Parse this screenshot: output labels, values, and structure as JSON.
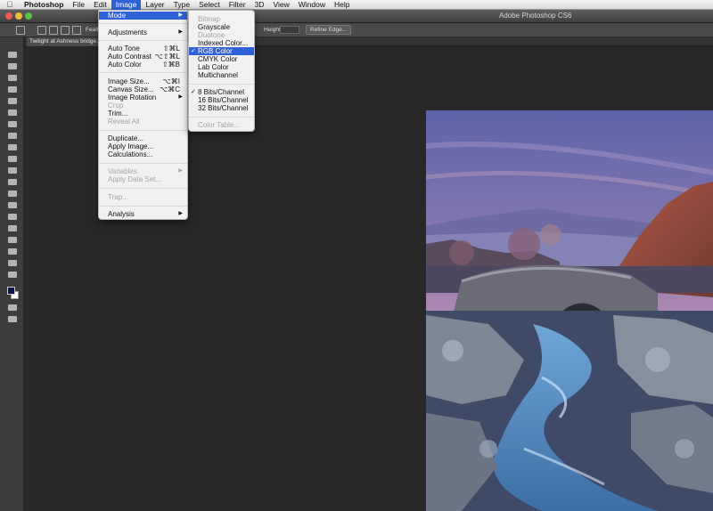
{
  "menubar": {
    "app": "Photoshop",
    "items": [
      "File",
      "Edit",
      "Image",
      "Layer",
      "Type",
      "Select",
      "Filter",
      "3D",
      "View",
      "Window",
      "Help"
    ]
  },
  "window": {
    "title": "Adobe Photoshop CS6"
  },
  "options_bar": {
    "feather_label": "Feathe",
    "height_label": "Height:",
    "refine_label": "Refine Edge..."
  },
  "document": {
    "tab_label": "Twilight at Ashness bridge.tif"
  },
  "image_menu": {
    "mode": "Mode",
    "adjustments": "Adjustments",
    "auto_tone": "Auto Tone",
    "auto_tone_sc": "⇧⌘L",
    "auto_contrast": "Auto Contrast",
    "auto_contrast_sc": "⌥⇧⌘L",
    "auto_color": "Auto Color",
    "auto_color_sc": "⇧⌘B",
    "image_size": "Image Size...",
    "image_size_sc": "⌥⌘I",
    "canvas_size": "Canvas Size...",
    "canvas_size_sc": "⌥⌘C",
    "image_rotation": "Image Rotation",
    "crop": "Crop",
    "trim": "Trim...",
    "reveal_all": "Reveal All",
    "duplicate": "Duplicate...",
    "apply_image": "Apply Image...",
    "calculations": "Calculations...",
    "variables": "Variables",
    "apply_data_set": "Apply Data Set...",
    "trap": "Trap...",
    "analysis": "Analysis"
  },
  "mode_menu": {
    "bitmap": "Bitmap",
    "grayscale": "Grayscale",
    "duotone": "Duotone",
    "indexed_color": "Indexed Color...",
    "rgb_color": "RGB Color",
    "cmyk_color": "CMYK Color",
    "lab_color": "Lab Color",
    "multichannel": "Multichannel",
    "bits8": "8 Bits/Channel",
    "bits16": "16 Bits/Channel",
    "bits32": "32 Bits/Channel",
    "color_table": "Color Table...",
    "check_mark": "✓"
  },
  "colors": {
    "menu_highlight": "#2f62d6",
    "foreground_swatch": "#0d1550",
    "background_swatch": "#ffffff"
  }
}
